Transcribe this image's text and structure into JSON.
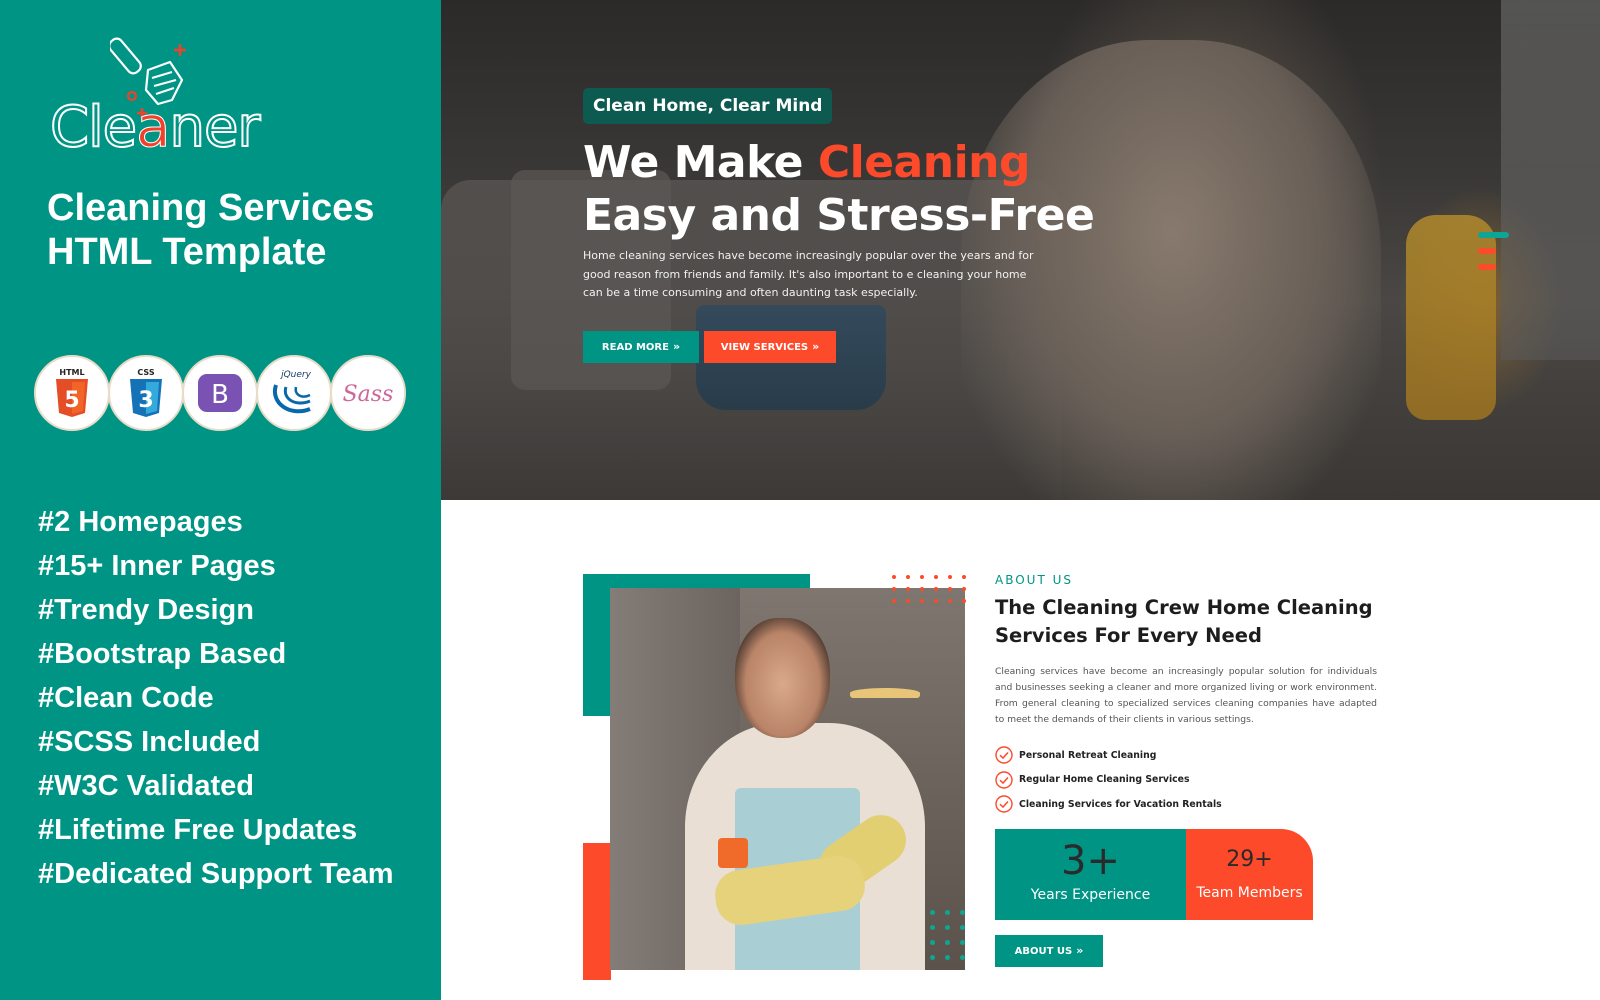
{
  "sidebar": {
    "logo": {
      "text_parts": [
        "Cl",
        "e",
        "a",
        "ner"
      ],
      "brand_name": "Cleaner"
    },
    "title_line1": "Cleaning Services",
    "title_line2": "HTML Template",
    "tech_badges": [
      {
        "name": "html5-icon",
        "label": "HTML"
      },
      {
        "name": "css3-icon",
        "label": "CSS"
      },
      {
        "name": "bootstrap-icon",
        "label": "B"
      },
      {
        "name": "jquery-icon",
        "label": "jQuery"
      },
      {
        "name": "sass-icon",
        "label": "Sass"
      }
    ],
    "features": [
      "#2 Homepages",
      "#15+ Inner Pages",
      "#Trendy Design",
      "#Bootstrap Based",
      "#Clean Code",
      "#SCSS Included",
      "#W3C Validated",
      "#Lifetime Free Updates",
      "#Dedicated Support Team"
    ]
  },
  "hero": {
    "tag": "Clean Home, Clear Mind",
    "title_part1": "We Make ",
    "title_accent": "Cleaning",
    "title_line2": "Easy and Stress-Free",
    "description": "Home cleaning services have become increasingly popular over the years and for good reason from friends and family. It's also important to e cleaning your home can be a time consuming and often daunting task especially.",
    "buttons": {
      "read_more": "Read More",
      "view_services": "View Services"
    },
    "slider_active_index": 0,
    "slider_count": 3
  },
  "about": {
    "kicker": "ABOUT US",
    "title": "The Cleaning Crew Home Cleaning Services For Every Need",
    "description": "Cleaning services have become an increasingly popular solution for individuals and businesses seeking a cleaner and more organized living or work environment. From general cleaning to specialized services cleaning companies have adapted to meet the demands of their clients in various settings.",
    "checklist": [
      "Personal Retreat Cleaning",
      "Regular Home Cleaning Services",
      "Cleaning Services for Vacation Rentals"
    ],
    "stats": [
      {
        "value": "3+",
        "label": "Years Experience"
      },
      {
        "value": "29+",
        "label": "Team Members"
      }
    ],
    "button": "About Us"
  },
  "colors": {
    "primary_teal": "#009485",
    "accent_red": "#fc4a2b",
    "tag_dark_teal": "#0c5a50",
    "heading_dark": "#1d1d1d"
  }
}
